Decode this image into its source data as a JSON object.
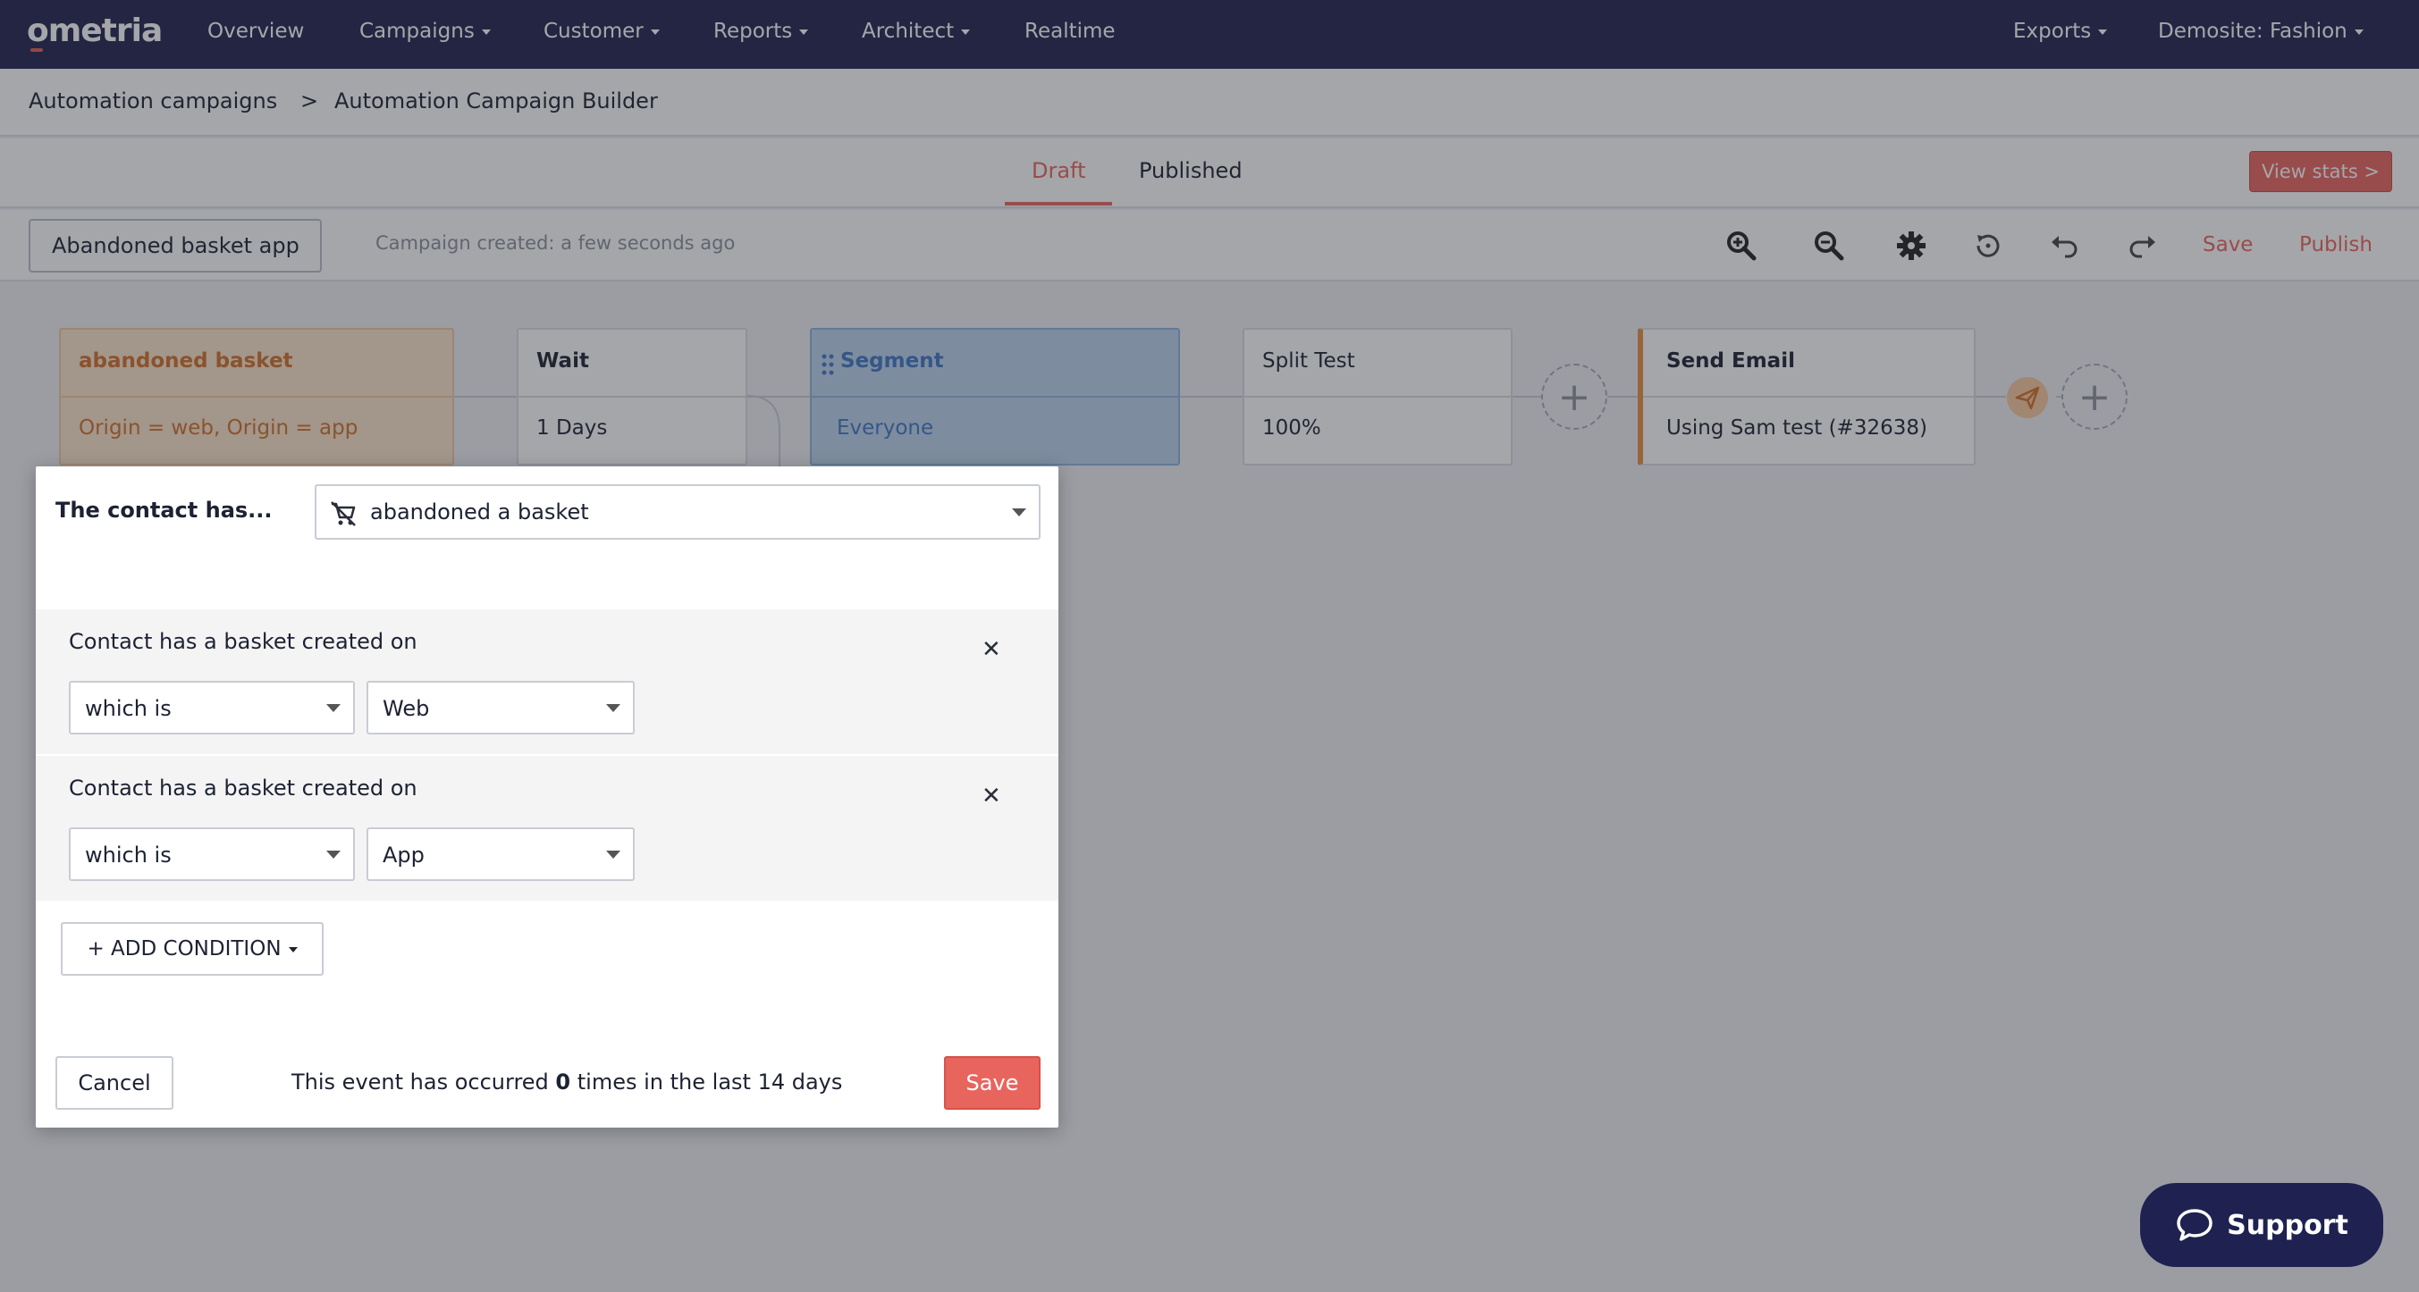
{
  "logo": "ometria",
  "nav": {
    "items": [
      "Overview",
      "Campaigns",
      "Customer",
      "Reports",
      "Architect",
      "Realtime"
    ],
    "exports": "Exports",
    "site": "Demosite: Fashion"
  },
  "breadcrumb": {
    "parent": "Automation campaigns",
    "separator": ">",
    "current": "Automation Campaign Builder"
  },
  "tabs": {
    "draft": "Draft",
    "published": "Published",
    "view_stats": "View stats >"
  },
  "toolbar": {
    "campaign_name": "Abandoned basket app",
    "created": "Campaign created: a few seconds ago",
    "icons": [
      "zoom-in-icon",
      "zoom-out-icon",
      "gear-icon",
      "history-icon",
      "undo-icon",
      "redo-icon"
    ],
    "save": "Save",
    "publish": "Publish"
  },
  "flow": {
    "trigger": {
      "title": "abandoned basket",
      "detail": "Origin = web, Origin = app"
    },
    "wait": {
      "title": "Wait",
      "detail": "1 Days"
    },
    "segment": {
      "title": "Segment",
      "detail": "Everyone"
    },
    "split": {
      "title": "Split Test",
      "detail": "100%"
    },
    "email": {
      "title": "Send Email",
      "detail": "Using Sam test (#32638)"
    }
  },
  "modal": {
    "contact_has": "The contact has...",
    "event": "abandoned a basket",
    "conditions": [
      {
        "label": "Contact has a basket created on",
        "operator": "which is",
        "value": "Web"
      },
      {
        "label": "Contact has a basket created on",
        "operator": "which is",
        "value": "App"
      }
    ],
    "add_condition": "+ ADD CONDITION",
    "cancel": "Cancel",
    "occurred_prefix": "This event has occurred",
    "occurred_count": "0",
    "occurred_suffix": "times in the last 14 days",
    "save": "Save"
  },
  "support": "Support",
  "colors": {
    "nav_bg": "#1f2250",
    "accent": "#e8655e",
    "trigger_fill": "#fbe3cc",
    "trigger_text": "#d1702a",
    "segment_fill": "#bcd3ee",
    "segment_text": "#3d78c4",
    "email_bar": "#e89040"
  }
}
